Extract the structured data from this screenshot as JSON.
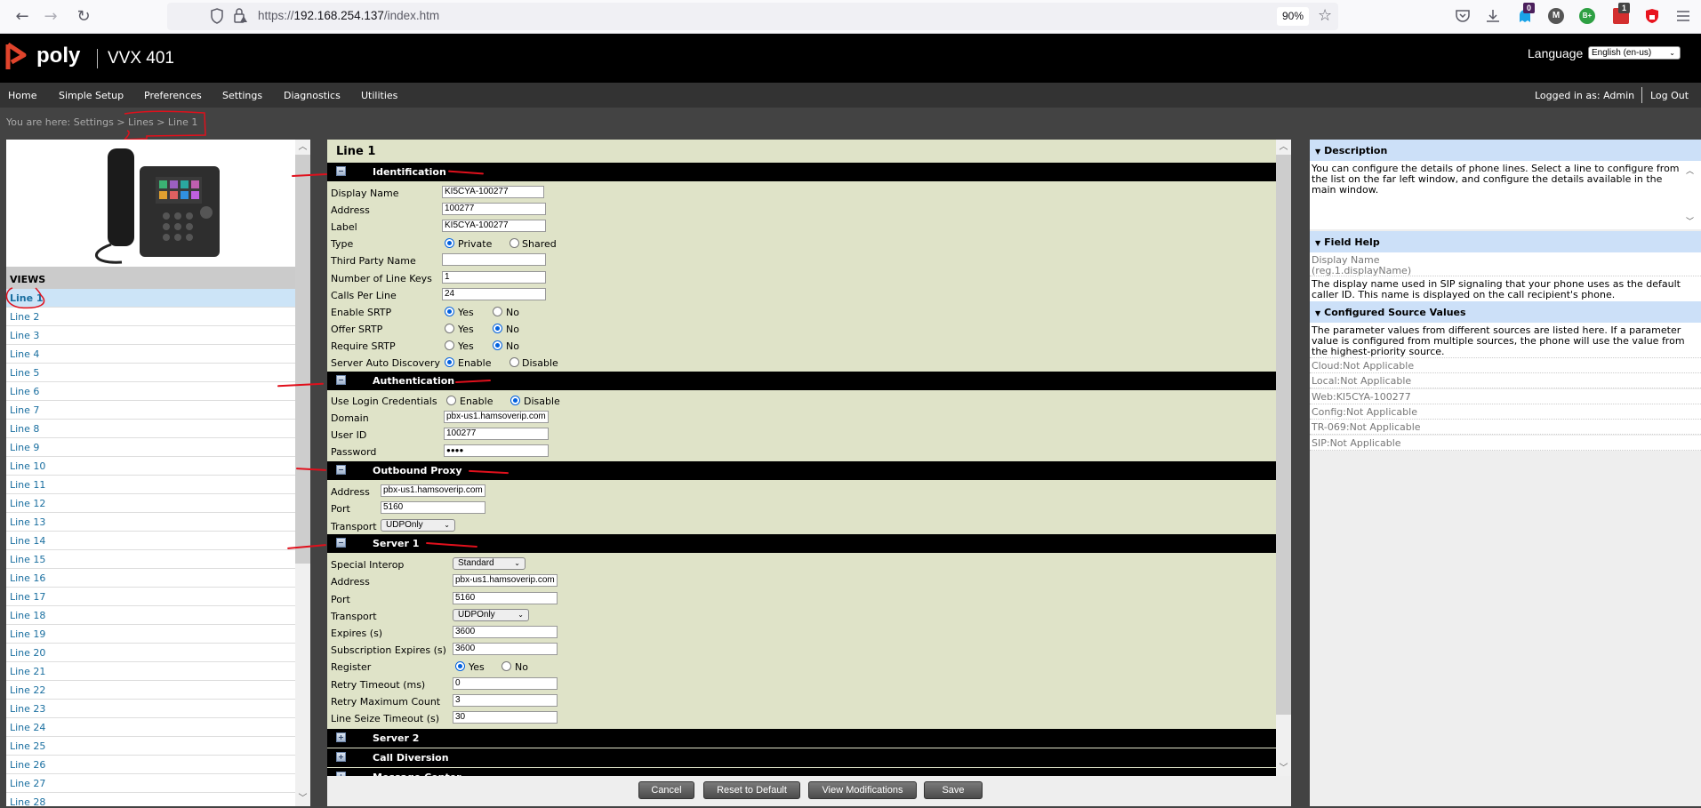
{
  "browser": {
    "url_prefix": "https://",
    "url_host": "192.168.254.137",
    "url_path": "/index.htm",
    "zoom": "90%",
    "extension_badges": {
      "ghostery": "0",
      "lastpass": "1"
    },
    "ext_m_label": "M",
    "ext_b_label": "B+"
  },
  "header": {
    "brand": "poly",
    "model": "VVX 401",
    "language_label": "Language",
    "language_value": "English (en-us)"
  },
  "menu": {
    "items": [
      "Home",
      "Simple Setup",
      "Preferences",
      "Settings",
      "Diagnostics",
      "Utilities"
    ],
    "logged_in": "Logged in as: Admin",
    "logout": "Log Out"
  },
  "breadcrumb": "You are here: Settings > Lines > Line 1",
  "left": {
    "views_label": "VIEWS",
    "lines": [
      "Line 1",
      "Line 2",
      "Line 3",
      "Line 4",
      "Line 5",
      "Line 6",
      "Line 7",
      "Line 8",
      "Line 9",
      "Line 10",
      "Line 11",
      "Line 12",
      "Line 13",
      "Line 14",
      "Line 15",
      "Line 16",
      "Line 17",
      "Line 18",
      "Line 19",
      "Line 20",
      "Line 21",
      "Line 22",
      "Line 23",
      "Line 24",
      "Line 25",
      "Line 26",
      "Line 27",
      "Line 28"
    ],
    "active_line": "Line 1"
  },
  "main": {
    "title": "Line 1",
    "identification": {
      "heading": "Identification",
      "display_name_label": "Display Name",
      "display_name": "KI5CYA-100277",
      "address_label": "Address",
      "address": "100277",
      "label_label": "Label",
      "label": "KI5CYA-100277",
      "type_label": "Type",
      "type_options": [
        "Private",
        "Shared"
      ],
      "type_selected": "Private",
      "third_party_label": "Third Party Name",
      "third_party": "",
      "line_keys_label": "Number of Line Keys",
      "line_keys": "1",
      "calls_per_line_label": "Calls Per Line",
      "calls_per_line": "24",
      "enable_srtp_label": "Enable SRTP",
      "enable_srtp": "Yes",
      "offer_srtp_label": "Offer SRTP",
      "offer_srtp": "No",
      "require_srtp_label": "Require SRTP",
      "require_srtp": "No",
      "auto_discovery_label": "Server Auto Discovery",
      "auto_discovery": "Enable",
      "yes": "Yes",
      "no": "No",
      "enable": "Enable",
      "disable": "Disable"
    },
    "authentication": {
      "heading": "Authentication",
      "use_login_label": "Use Login Credentials",
      "use_login": "Disable",
      "enable": "Enable",
      "disable": "Disable",
      "domain_label": "Domain",
      "domain": "pbx-us1.hamsoverip.com",
      "user_id_label": "User ID",
      "user_id": "100277",
      "password_label": "Password",
      "password_mask": "●●●●"
    },
    "outbound_proxy": {
      "heading": "Outbound Proxy",
      "address_label": "Address",
      "address": "pbx-us1.hamsoverip.com",
      "port_label": "Port",
      "port": "5160",
      "transport_label": "Transport",
      "transport": "UDPOnly"
    },
    "server1": {
      "heading": "Server 1",
      "interop_label": "Special Interop",
      "interop": "Standard",
      "address_label": "Address",
      "address": "pbx-us1.hamsoverip.com",
      "port_label": "Port",
      "port": "5160",
      "transport_label": "Transport",
      "transport": "UDPOnly",
      "expires_label": "Expires (s)",
      "expires": "3600",
      "sub_expires_label": "Subscription Expires (s)",
      "sub_expires": "3600",
      "register_label": "Register",
      "register": "Yes",
      "yes": "Yes",
      "no": "No",
      "retry_timeout_label": "Retry Timeout (ms)",
      "retry_timeout": "0",
      "retry_max_label": "Retry Maximum Count",
      "retry_max": "3",
      "seize_label": "Line Seize Timeout (s)",
      "seize": "30"
    },
    "collapsed_sections": [
      "Server 2",
      "Call Diversion",
      "Message Center"
    ]
  },
  "buttons": {
    "cancel": "Cancel",
    "reset": "Reset to Default",
    "view_mods": "View Modifications",
    "save": "Save"
  },
  "right": {
    "description_heading": "Description",
    "description": "You can configure the details of phone lines. Select a line to configure from the list on the far left window, and configure the details available in the main window.",
    "field_help_heading": "Field Help",
    "field_name": "Display Name",
    "field_param": "(reg.1.displayName)",
    "field_desc": "The display name used in SIP signaling that your phone uses as the default caller ID. This name is displayed on the call recipient's phone.",
    "sources_heading": "Configured Source Values",
    "sources_desc": "The parameter values from different sources are listed here. If a parameter value is configured from multiple sources, the phone will use the value from the highest-priority source.",
    "sources": [
      "Cloud:Not Applicable",
      "Local:Not Applicable",
      "Web:KI5CYA-100277",
      "Config:Not Applicable",
      "TR-069:Not Applicable",
      "SIP:Not Applicable"
    ]
  },
  "colors": {
    "brand_red": "#e0442c",
    "main_bg": "#dfe3c8",
    "link_blue": "#1a6fa0",
    "selected_bg": "#cce4f7",
    "help_head": "#cce0f8"
  }
}
